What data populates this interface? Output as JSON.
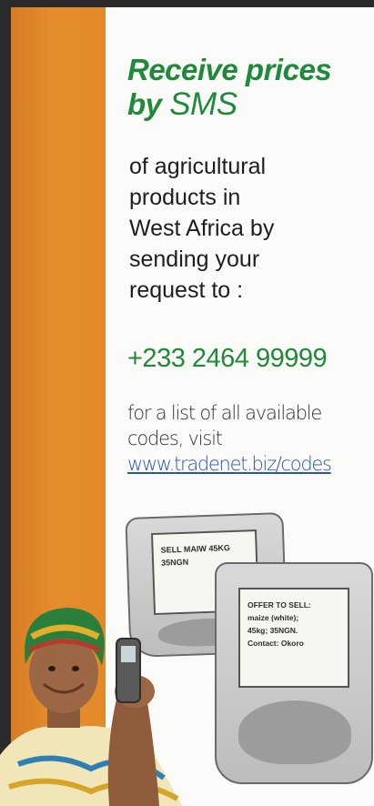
{
  "headline": {
    "line1": "Receive prices",
    "by": "by",
    "sms": "SMS"
  },
  "body": {
    "line1": "of agricultural",
    "line2": "products in",
    "line3": "West Africa by",
    "line4": "sending your",
    "line5": "request to :"
  },
  "phone_number": "+233 2464 99999",
  "info": {
    "line1": "for a list of all available",
    "line2": "codes, visit",
    "link": "www.tradenet.biz/codes"
  },
  "phone_a_screen": {
    "line1": "SELL MAIW 45KG",
    "line2": "35NGN"
  },
  "phone_b_screen": {
    "line1": "OFFER TO SELL:",
    "line2": "maize (white);",
    "line3": "45kg; 35NGN.",
    "line4": "Contact: Okoro"
  },
  "colors": {
    "accent_green": "#1f8a3a",
    "orange": "#e58d2d",
    "link_blue": "#2956b2"
  }
}
